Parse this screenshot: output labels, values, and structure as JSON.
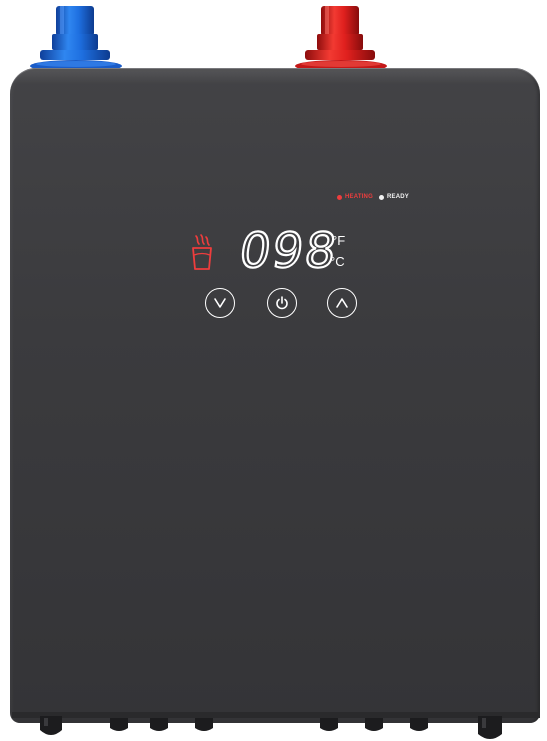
{
  "device": {
    "colors": {
      "body": "#3c3c3f",
      "cold_fitting": "#1e6fe0",
      "hot_fitting": "#e0201e",
      "heating_indicator": "#ee3d3d",
      "display_text": "#ffffff"
    },
    "inlets": [
      {
        "name": "cold-inlet",
        "color": "#1e6fe0"
      },
      {
        "name": "hot-outlet",
        "color": "#e0201e"
      }
    ]
  },
  "status": {
    "heating_label": "HEATING",
    "ready_label": "READY"
  },
  "display": {
    "temperature": "098",
    "unit_f": "°F",
    "unit_c": "°C",
    "icon": "hot-cup-icon"
  },
  "controls": {
    "down_icon": "chevron-down-icon",
    "power_icon": "power-icon",
    "up_icon": "chevron-up-icon"
  }
}
